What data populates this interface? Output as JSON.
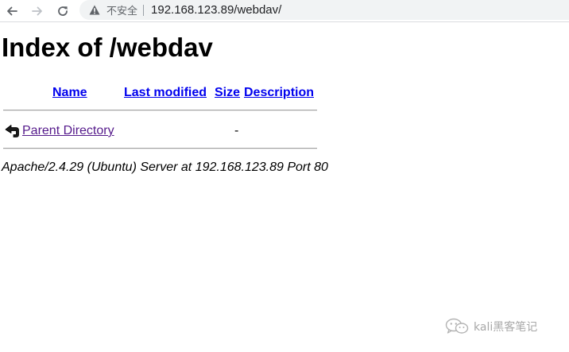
{
  "browser": {
    "security_label": "不安全",
    "url": "192.168.123.89/webdav/",
    "icons": {
      "back": "arrow-left-icon",
      "forward": "arrow-right-icon",
      "reload": "reload-icon",
      "security": "warning-triangle-icon"
    }
  },
  "page": {
    "title": "Index of /webdav",
    "columns": {
      "name": "Name",
      "last_modified": "Last modified",
      "size": "Size",
      "description": "Description"
    },
    "rows": [
      {
        "icon": "back-arrow-icon",
        "name": "Parent Directory",
        "last_modified": "",
        "size": "-",
        "description": ""
      }
    ],
    "server_signature": "Apache/2.4.29 (Ubuntu) Server at 192.168.123.89 Port 80"
  },
  "colors": {
    "link": "#0000ee",
    "visited_link": "#551a8b",
    "omnibox_bg": "#f1f3f4"
  },
  "watermark": {
    "text": "kali黑客笔记",
    "icon": "wechat-icon"
  }
}
